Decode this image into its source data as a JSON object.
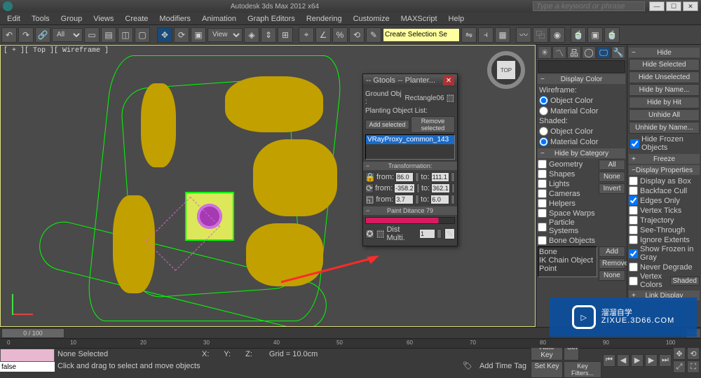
{
  "titlebar": {
    "title": "Autodesk 3ds Max 2012 x64",
    "search_placeholder": "Type a keyword or phrase"
  },
  "winbtns": {
    "min": "—",
    "max": "☐",
    "close": "✕"
  },
  "menu": [
    "Edit",
    "Tools",
    "Group",
    "Views",
    "Create",
    "Modifiers",
    "Animation",
    "Graph Editors",
    "Rendering",
    "Customize",
    "MAXScript",
    "Help"
  ],
  "toolbar": {
    "sel_all": "All",
    "sel_view": "View",
    "named_sel": "Create Selection Se"
  },
  "viewport_label": "[ + ][ Top ][ Wireframe ]",
  "viewcube": "TOP",
  "dialog": {
    "title": "-- Gtools -- Planter...",
    "ground_label": "Ground Obj :",
    "ground_value": "Rectangle06",
    "list_label": "Planting Object List:",
    "add": "Add selected",
    "remove": "Remove selected",
    "item": "VRayProxy_common_143",
    "sec_trans": "Transformation:",
    "from": "from:",
    "to": "to:",
    "r1a": "86.0",
    "r1b": "111.1",
    "r2a": "-358.2",
    "r2b": "362.1",
    "r3a": "3.7",
    "r3b": "6.0",
    "sec_paint": "Paint Ditance  79",
    "dist": "Dist Multi.",
    "distval": "1"
  },
  "display": {
    "head_color": "Display Color",
    "wireframe": "Wireframe:",
    "shaded": "Shaded:",
    "objcolor": "Object Color",
    "matcolor": "Material Color",
    "head_cat": "Hide by Category",
    "cats": [
      "Geometry",
      "Shapes",
      "Lights",
      "Cameras",
      "Helpers",
      "Space Warps",
      "Particle Systems",
      "Bone Objects"
    ],
    "btn_all": "All",
    "btn_none": "None",
    "btn_invert": "Invert",
    "list": [
      "Bone",
      "IK Chain Object",
      "Point"
    ],
    "btn_add": "Add",
    "btn_remove": "Remove",
    "btn_none2": "None"
  },
  "hide": {
    "head": "Hide",
    "btns": [
      "Hide Selected",
      "Hide Unselected",
      "Hide by Name...",
      "Hide by Hit",
      "Unhide All",
      "Unhide by Name..."
    ],
    "chk_frozen": "Hide Frozen Objects",
    "head_freeze": "Freeze",
    "head_props": "Display Properties",
    "props": [
      "Display as Box",
      "Backface Cull",
      "Edges Only",
      "Vertex Ticks",
      "Trajectory",
      "See-Through",
      "Ignore Extents",
      "Show Frozen in Gray",
      "Never Degrade",
      "Vertex Colors"
    ],
    "shaded_btn": "Shaded",
    "head_link": "Link Display"
  },
  "timeline": {
    "handle": "0 / 100",
    "ticks": [
      "0",
      "10",
      "20",
      "30",
      "40",
      "50",
      "60",
      "70",
      "80",
      "90",
      "100"
    ]
  },
  "status": {
    "prompt": "false",
    "line1": "None Selected",
    "line2": "Click and drag to select and move objects",
    "x": "X:",
    "y": "Y:",
    "z": "Z:",
    "grid": "Grid = 10.0cm",
    "addtag": "Add Time Tag",
    "autokey": "Auto Key",
    "sel": "Sel",
    "setkey": "Set Key",
    "keyfilt": "Key Filters..."
  },
  "watermark": {
    "big": "溜溜自学",
    "url": "ZIXUE.3D66.COM"
  }
}
